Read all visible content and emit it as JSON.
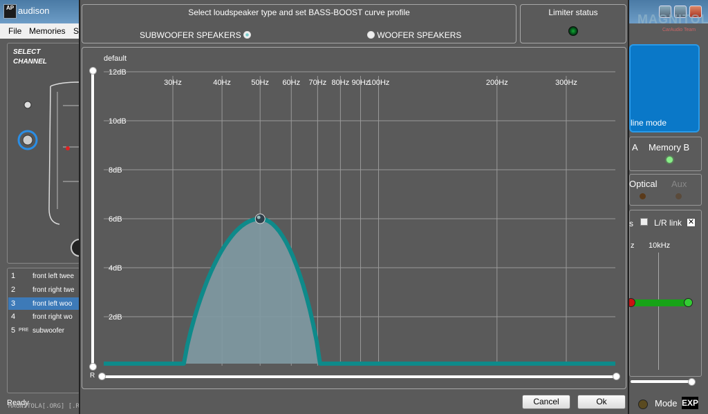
{
  "app": {
    "title": "audison",
    "logo_text": "AP",
    "menu": [
      "File",
      "Memories",
      "S"
    ],
    "select_channel": "SELECT\nCHANNEL",
    "channels": [
      {
        "num": "1",
        "pre": "",
        "label": "front left twee"
      },
      {
        "num": "2",
        "pre": "",
        "label": "front right twe"
      },
      {
        "num": "3",
        "pre": "",
        "label": "front left woo",
        "selected": true
      },
      {
        "num": "4",
        "pre": "",
        "label": "front right wo"
      },
      {
        "num": "5",
        "pre": "PRE",
        "label": "subwoofer"
      }
    ],
    "status": "Ready",
    "watermark": "MAGNITOLA[.ORG] [.RU] [.NET]",
    "right": {
      "online_mode": "line mode",
      "memory_a": "A",
      "memory_b": "Memory B",
      "optical": "Optical",
      "aux": "Aux",
      "lr_link": "L/R link",
      "khz": "10kHz",
      "hz": "z",
      "s": "s",
      "mode": "Mode",
      "exp": "EXP"
    },
    "brand_watermark": "MAGNITOLA",
    "brand_sub": "CarAudio Team"
  },
  "dialog": {
    "type_title": "Select loudspeaker type and set BASS-BOOST curve profile",
    "subwoofer_label": "SUBWOOFER SPEAKERS",
    "woofer_label": "WOOFER SPEAKERS",
    "selected_type": "subwoofer",
    "limiter_title": "Limiter status",
    "default_label": "default",
    "r_label": "R",
    "cancel": "Cancel",
    "ok": "Ok"
  },
  "colors": {
    "curve": "#0e8a8a",
    "fill": "#7f9aa3",
    "grid": "#9a9a9a",
    "limiter_led": "#063"
  },
  "chart_data": {
    "type": "area",
    "x_scale": "log",
    "x_ticks": [
      {
        "label": "30Hz",
        "value": 30
      },
      {
        "label": "40Hz",
        "value": 40
      },
      {
        "label": "50Hz",
        "value": 50
      },
      {
        "label": "60Hz",
        "value": 60
      },
      {
        "label": "70Hz",
        "value": 70
      },
      {
        "label": "80Hz",
        "value": 80
      },
      {
        "label": "90Hz",
        "value": 90
      },
      {
        "label": "100Hz",
        "value": 100
      },
      {
        "label": "200Hz",
        "value": 200
      },
      {
        "label": "300Hz",
        "value": 300
      }
    ],
    "y_ticks": [
      "12dB",
      "10dB",
      "8dB",
      "6dB",
      "4dB",
      "2dB"
    ],
    "ylim": [
      0,
      12
    ],
    "y_tick_values": [
      12,
      10,
      8,
      6,
      4,
      2
    ],
    "boost": {
      "center_hz": 50,
      "gain_db": 6,
      "low_edge_hz": 32,
      "high_edge_hz": 71
    },
    "grid": true
  }
}
